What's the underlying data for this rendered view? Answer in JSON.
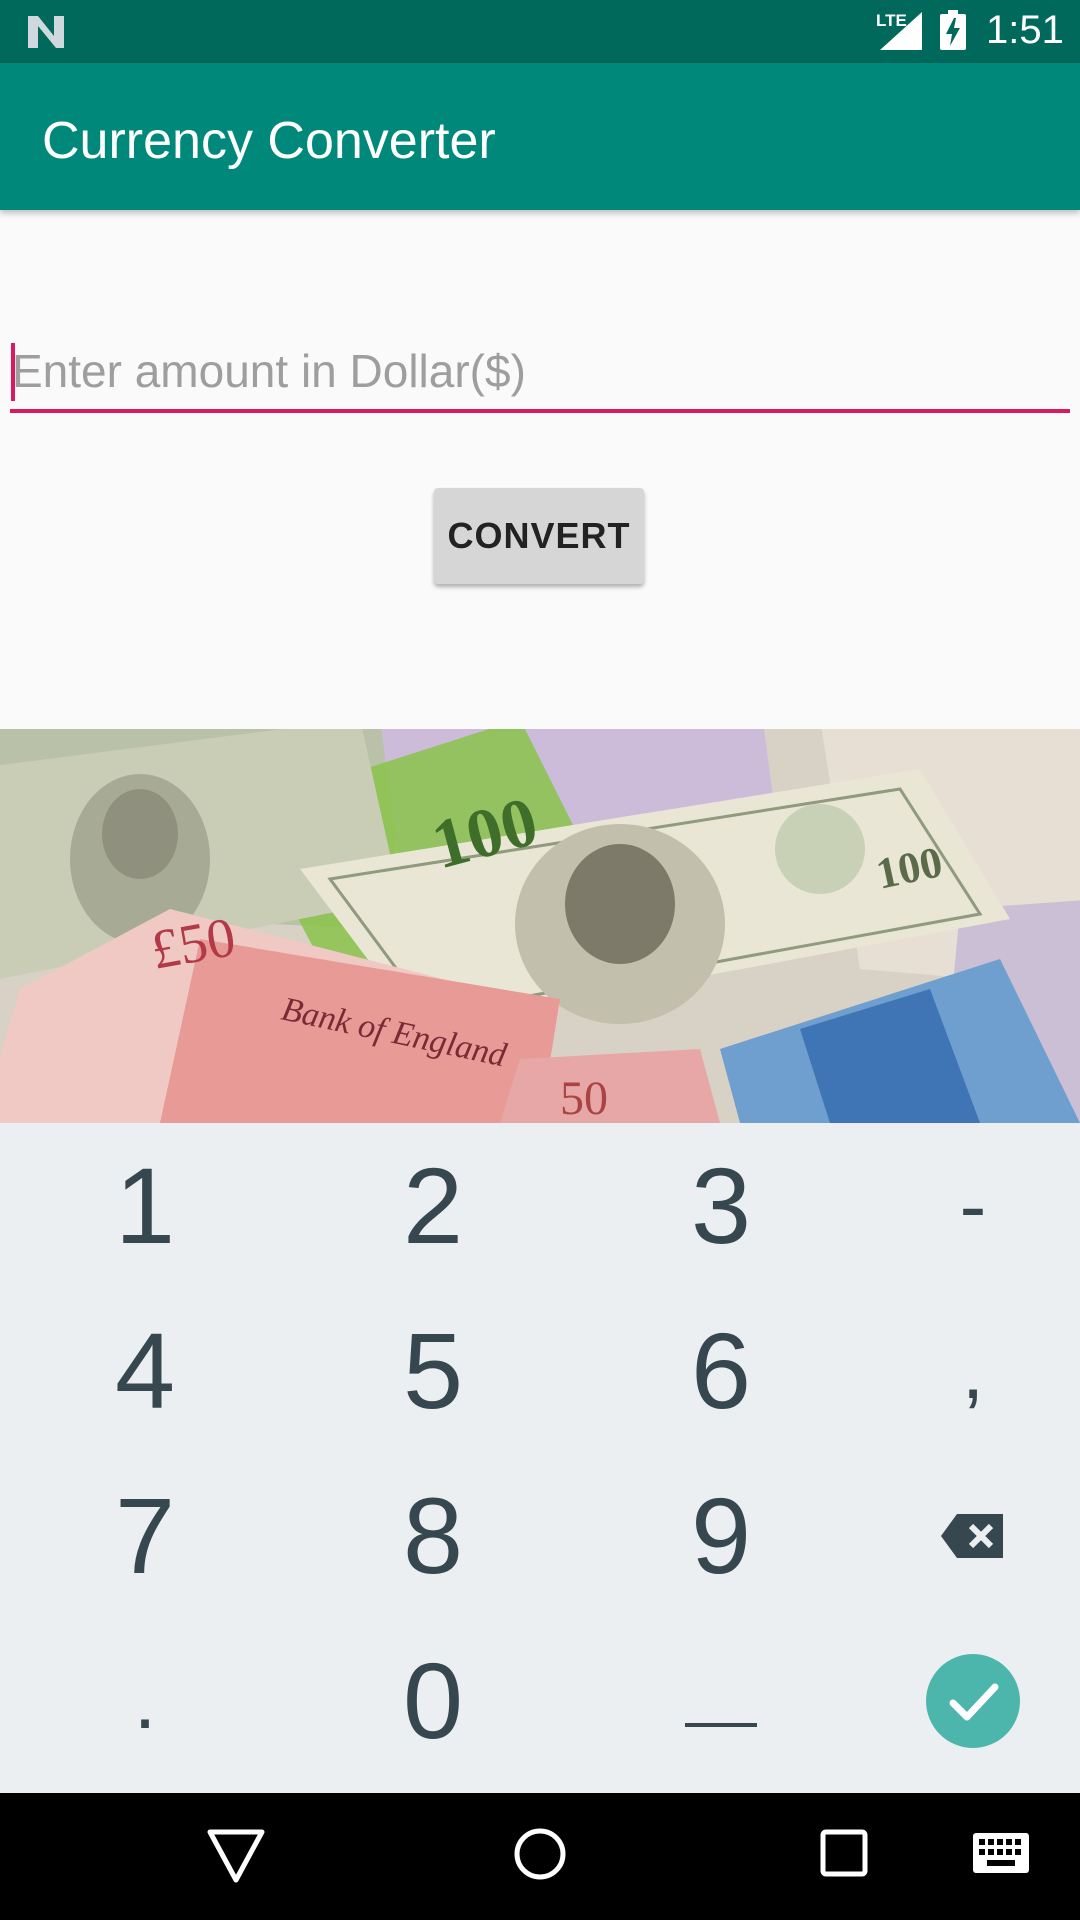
{
  "status_bar": {
    "time": "1:51",
    "network": "LTE"
  },
  "app_bar": {
    "title": "Currency Converter"
  },
  "input": {
    "placeholder": "Enter amount in Dollar($)",
    "value": ""
  },
  "convert_button": {
    "label": "CONVERT"
  },
  "keyboard": {
    "rows": [
      [
        "1",
        "2",
        "3",
        "-"
      ],
      [
        "4",
        "5",
        "6",
        ","
      ],
      [
        "7",
        "8",
        "9",
        "backspace"
      ],
      [
        ".",
        "0",
        "_",
        "done"
      ]
    ]
  },
  "colors": {
    "primary": "#00897b",
    "primary_dark": "#00695c",
    "accent": "#d81b60",
    "done_key": "#4db6ac"
  }
}
